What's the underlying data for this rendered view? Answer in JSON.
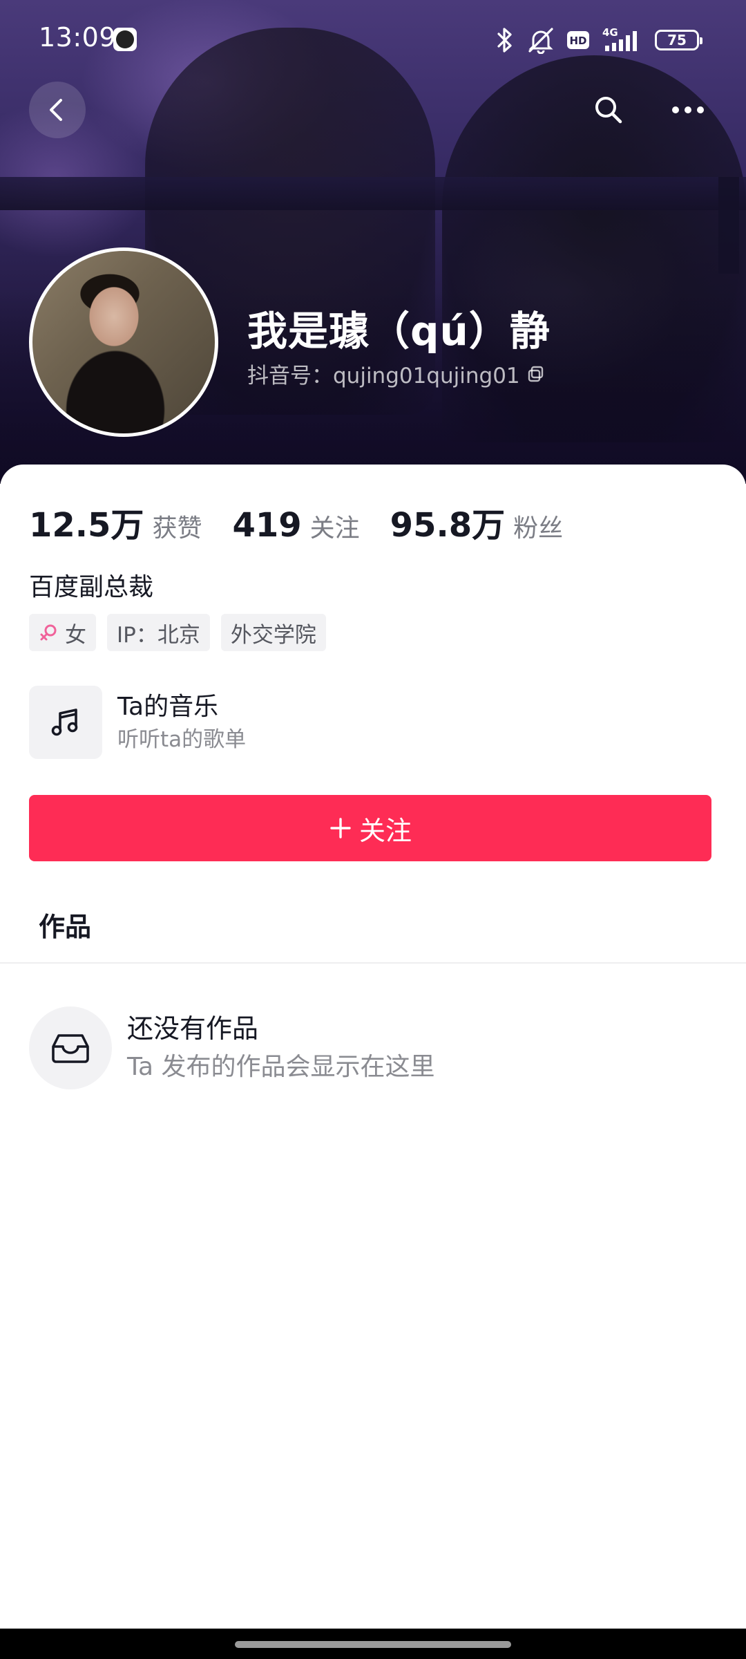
{
  "status_bar": {
    "time": "13:09",
    "network_label": "4G",
    "hd_label": "HD",
    "battery_level": "75"
  },
  "header": {
    "back_icon": "chevron-left-icon",
    "search_icon": "search-icon",
    "more_icon": "more-horizontal-icon"
  },
  "profile": {
    "name": "我是璩（qú）静",
    "douyin_id": "抖音号：qujing01qujing01",
    "copy_icon": "copy-icon"
  },
  "stats": [
    {
      "value": "12.5万",
      "label": "获赞"
    },
    {
      "value": "419",
      "label": "关注"
    },
    {
      "value": "95.8万",
      "label": "粉丝"
    }
  ],
  "bio": "百度副总裁",
  "tags": {
    "gender": "女",
    "gender_icon": "female-icon",
    "ip": "IP：北京",
    "school": "外交学院"
  },
  "music": {
    "icon": "music-note-icon",
    "title": "Ta的音乐",
    "subtitle": "听听ta的歌单"
  },
  "follow_button": {
    "plus": "+",
    "label": "关注",
    "color": "#fe2c55"
  },
  "tabs": {
    "works": "作品"
  },
  "empty_state": {
    "icon": "inbox-icon",
    "title": "还没有作品",
    "subtitle": "Ta 发布的作品会显示在这里"
  }
}
